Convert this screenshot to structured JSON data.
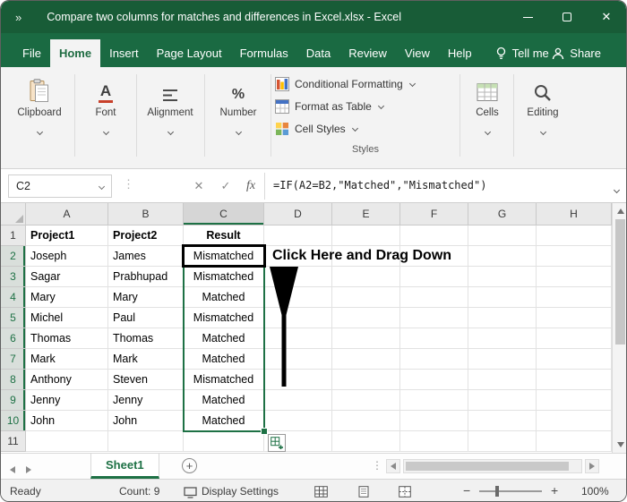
{
  "title_bar": {
    "quick_access_glyph": "»",
    "title": "Compare two columns for matches and differences in Excel.xlsx  -  Excel",
    "close_glyph": "✕"
  },
  "ribbon": {
    "tabs": [
      {
        "label": "File",
        "active": false
      },
      {
        "label": "Home",
        "active": true
      },
      {
        "label": "Insert",
        "active": false
      },
      {
        "label": "Page Layout",
        "active": false
      },
      {
        "label": "Formulas",
        "active": false
      },
      {
        "label": "Data",
        "active": false
      },
      {
        "label": "Review",
        "active": false
      },
      {
        "label": "View",
        "active": false
      },
      {
        "label": "Help",
        "active": false
      }
    ],
    "tell_me": "Tell me",
    "share": "Share",
    "groups": [
      {
        "label": "Clipboard"
      },
      {
        "label": "Font"
      },
      {
        "label": "Alignment"
      },
      {
        "label": "Number"
      }
    ],
    "styles_group": {
      "items": [
        "Conditional Formatting",
        "Format as Table",
        "Cell Styles"
      ],
      "caption": "Styles"
    },
    "right_groups": [
      {
        "label": "Cells"
      },
      {
        "label": "Editing"
      }
    ],
    "icons": {
      "font_letter": "A",
      "percent": "%"
    }
  },
  "formula_bar": {
    "name_box": "C2",
    "handle_glyph": "⋮",
    "cancel_glyph": "✕",
    "enter_glyph": "✓",
    "fx_label": "fx",
    "formula": "=IF(A2=B2,\"Matched\",\"Mismatched\")"
  },
  "grid": {
    "col_headers": [
      "A",
      "B",
      "C",
      "D",
      "E",
      "F",
      "G",
      "H"
    ],
    "selected_col": "C",
    "active_cell": "C2",
    "selected_range": "C2:C10",
    "rows": [
      {
        "n": "1",
        "A": "Project1",
        "B": "Project2",
        "C": "Result",
        "header": true,
        "sel": false
      },
      {
        "n": "2",
        "A": "Joseph",
        "B": "James",
        "C": "Mismatched",
        "sel": true
      },
      {
        "n": "3",
        "A": "Sagar",
        "B": "Prabhupad",
        "C": "Mismatched",
        "sel": true
      },
      {
        "n": "4",
        "A": "Mary",
        "B": "Mary",
        "C": "Matched",
        "sel": true
      },
      {
        "n": "5",
        "A": "Michel",
        "B": "Paul",
        "C": "Mismatched",
        "sel": true
      },
      {
        "n": "6",
        "A": "Thomas",
        "B": "Thomas",
        "C": "Matched",
        "sel": true
      },
      {
        "n": "7",
        "A": "Mark",
        "B": "Mark",
        "C": "Matched",
        "sel": true
      },
      {
        "n": "8",
        "A": "Anthony",
        "B": "Steven",
        "C": "Mismatched",
        "sel": true
      },
      {
        "n": "9",
        "A": "Jenny",
        "B": "Jenny",
        "C": "Matched",
        "sel": true
      },
      {
        "n": "10",
        "A": "John",
        "B": "John",
        "C": "Matched",
        "sel": true
      },
      {
        "n": "11",
        "A": "",
        "B": "",
        "C": "",
        "sel": false
      }
    ]
  },
  "annotation": {
    "text": "Click Here and Drag Down"
  },
  "sheet_bar": {
    "tab": "Sheet1",
    "add_glyph": "+"
  },
  "status_bar": {
    "mode": "Ready",
    "count": "Count: 9",
    "display_settings": "Display Settings",
    "zoom_out": "−",
    "zoom_in": "+",
    "zoom_level": "100%"
  }
}
